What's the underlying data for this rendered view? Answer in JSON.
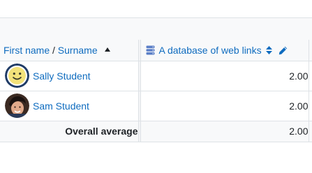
{
  "header": {
    "first_name_label": "First name",
    "separator": "/",
    "surname_label": "Surname",
    "item_label": "A database of web links",
    "item_icon": "database-icon",
    "sort_icon": "sort-updown-icon",
    "edit_icon": "pencil-icon"
  },
  "students": [
    {
      "name": "Sally Student",
      "avatar": "smiley-avatar",
      "grade": "2.00"
    },
    {
      "name": "Sam Student",
      "avatar": "photo-avatar",
      "grade": "2.00"
    }
  ],
  "average": {
    "label": "Overall average",
    "value": "2.00"
  },
  "colors": {
    "link": "#0f6cbf",
    "header_bg": "#f8f9fa",
    "border": "#dee2e6",
    "text": "#1d2125"
  }
}
